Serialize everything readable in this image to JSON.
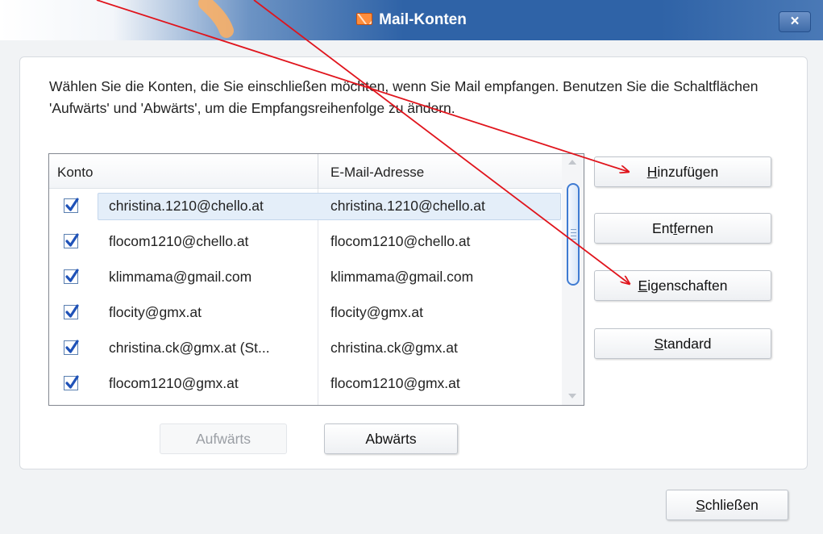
{
  "window": {
    "title": "Mail-Konten",
    "close_label": "×"
  },
  "instructions": "Wählen Sie die Konten, die Sie einschließen möchten, wenn Sie Mail empfangen. Benutzen Sie die Schaltflächen 'Aufwärts' und 'Abwärts', um die Empfangsreihenfolge zu ändern.",
  "list": {
    "headers": [
      "Konto",
      "E-Mail-Adresse"
    ],
    "rows": [
      {
        "checked": true,
        "konto": "christina.1210@chello.at",
        "email": "christina.1210@chello.at",
        "selected": true
      },
      {
        "checked": true,
        "konto": "flocom1210@chello.at",
        "email": "flocom1210@chello.at",
        "selected": false
      },
      {
        "checked": true,
        "konto": "klimmama@gmail.com",
        "email": "klimmama@gmail.com",
        "selected": false
      },
      {
        "checked": true,
        "konto": "flocity@gmx.at",
        "email": "flocity@gmx.at",
        "selected": false
      },
      {
        "checked": true,
        "konto": "christina.ck@gmx.at (St...",
        "email": "christina.ck@gmx.at",
        "selected": false
      },
      {
        "checked": true,
        "konto": "flocom1210@gmx.at",
        "email": "flocom1210@gmx.at",
        "selected": false
      }
    ]
  },
  "buttons": {
    "add": {
      "access_key": "H",
      "rest": "inzufügen"
    },
    "remove": {
      "pre": "Ent",
      "access_key": "f",
      "rest": "ernen"
    },
    "properties": {
      "access_key": "E",
      "rest": "igenschaften"
    },
    "default": {
      "access_key": "S",
      "rest": "tandard"
    },
    "up": {
      "label": "Aufwärts",
      "enabled": false
    },
    "down": {
      "label": "Abwärts",
      "enabled": true
    },
    "close": {
      "access_key": "S",
      "rest": "chließen"
    }
  },
  "colors": {
    "annotation_arrow": "#e0141c",
    "annotation_brush": "#ffb061"
  }
}
